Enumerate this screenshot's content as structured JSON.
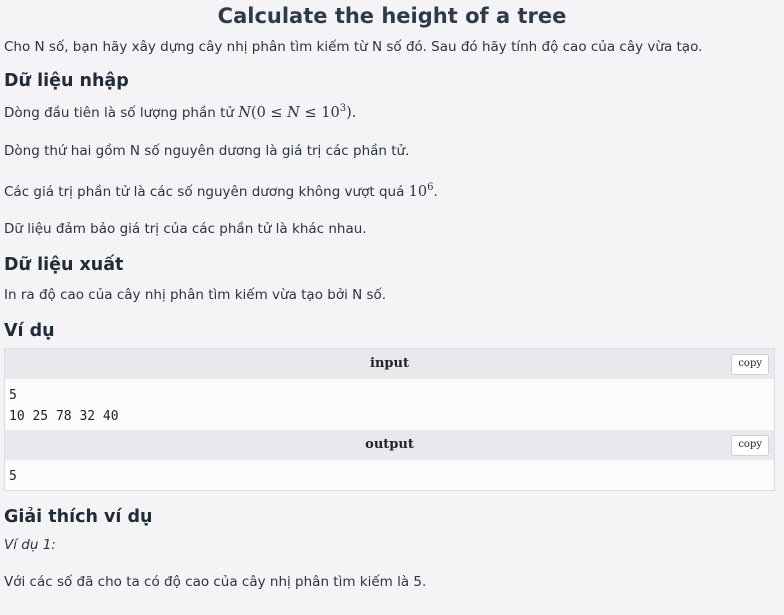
{
  "title": "Calculate the height of a tree",
  "intro": "Cho N số, bạn hãy xây dựng cây nhị phân tìm kiếm từ N số đó. Sau đó hãy tính độ cao của cây vừa tạo.",
  "input_section": {
    "heading": "Dữ liệu nhập",
    "line1_prefix": "Dòng đầu tiên là số lượng phần tử ",
    "line1_math": {
      "var": "N",
      "open": "(0 ≤ ",
      "var2": "N",
      "rel": " ≤ 10",
      "exp": "3",
      "close": ")."
    },
    "line2": "Dòng thứ hai gồm N số nguyên dương là giá trị các phần tử.",
    "line3_prefix": "Các giá trị phần tử là các số nguyên dương không vượt quá ",
    "line3_math": {
      "base": "10",
      "exp": "6",
      "suffix": "."
    },
    "line4": "Dữ liệu đảm bảo giá trị của các phần tử là khác nhau."
  },
  "output_section": {
    "heading": "Dữ liệu xuất",
    "line1": "In ra độ cao của cây nhị phân tìm kiếm vừa tạo bởi N số."
  },
  "example_section": {
    "heading": "Ví dụ",
    "input_label": "input",
    "input_value": "5\n10 25 78 32 40",
    "output_label": "output",
    "output_value": "5",
    "copy_label": "copy"
  },
  "explanation_section": {
    "heading": "Giải thích ví dụ",
    "example_label": "Ví dụ 1:",
    "text": "Với các số đã cho ta có độ cao của cây nhị phân tìm kiếm là 5."
  }
}
